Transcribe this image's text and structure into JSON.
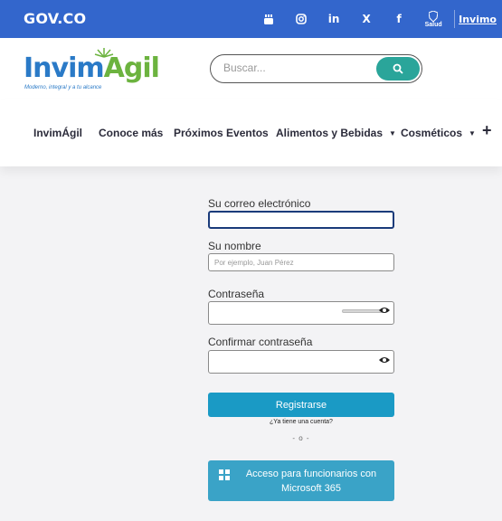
{
  "govbar": {
    "logo": "GOV.CO",
    "icons": [
      "youtube-icon",
      "instagram-icon",
      "linkedin-icon",
      "x-icon",
      "facebook-icon"
    ],
    "linkedin_text": "in",
    "x_text": "X",
    "facebook_text": "f",
    "salud_label": "Salud",
    "invimo_label": "Invimo",
    "bg_color": "#3366cc"
  },
  "header": {
    "logo": {
      "part1": "Invim",
      "part2": "Agil",
      "tagline": "Moderno, integral y a tu alcance"
    },
    "search": {
      "placeholder": "Buscar..."
    }
  },
  "nav": {
    "items": [
      {
        "label": "InvimÁgil"
      },
      {
        "label": "Conoce más"
      },
      {
        "label": "Próximos Eventos"
      },
      {
        "label": "Alimentos y Bebidas",
        "dropdown": true
      },
      {
        "label": "Cosméticos",
        "dropdown": true
      }
    ],
    "more": "+"
  },
  "form": {
    "email": {
      "label": "Su correo electrónico",
      "value": ""
    },
    "name": {
      "label": "Su nombre",
      "placeholder": "Por ejemplo, Juan Pérez",
      "value": ""
    },
    "password": {
      "label": "Contraseña",
      "value": ""
    },
    "confirm": {
      "label": "Confirmar contraseña",
      "value": ""
    },
    "register_button": "Registrarse",
    "have_account": "¿Ya tiene una cuenta?",
    "divider": "- o -",
    "ms_button": "Acceso para funcionarios con Microsoft 365",
    "accent_color": "#1a9ac5"
  }
}
